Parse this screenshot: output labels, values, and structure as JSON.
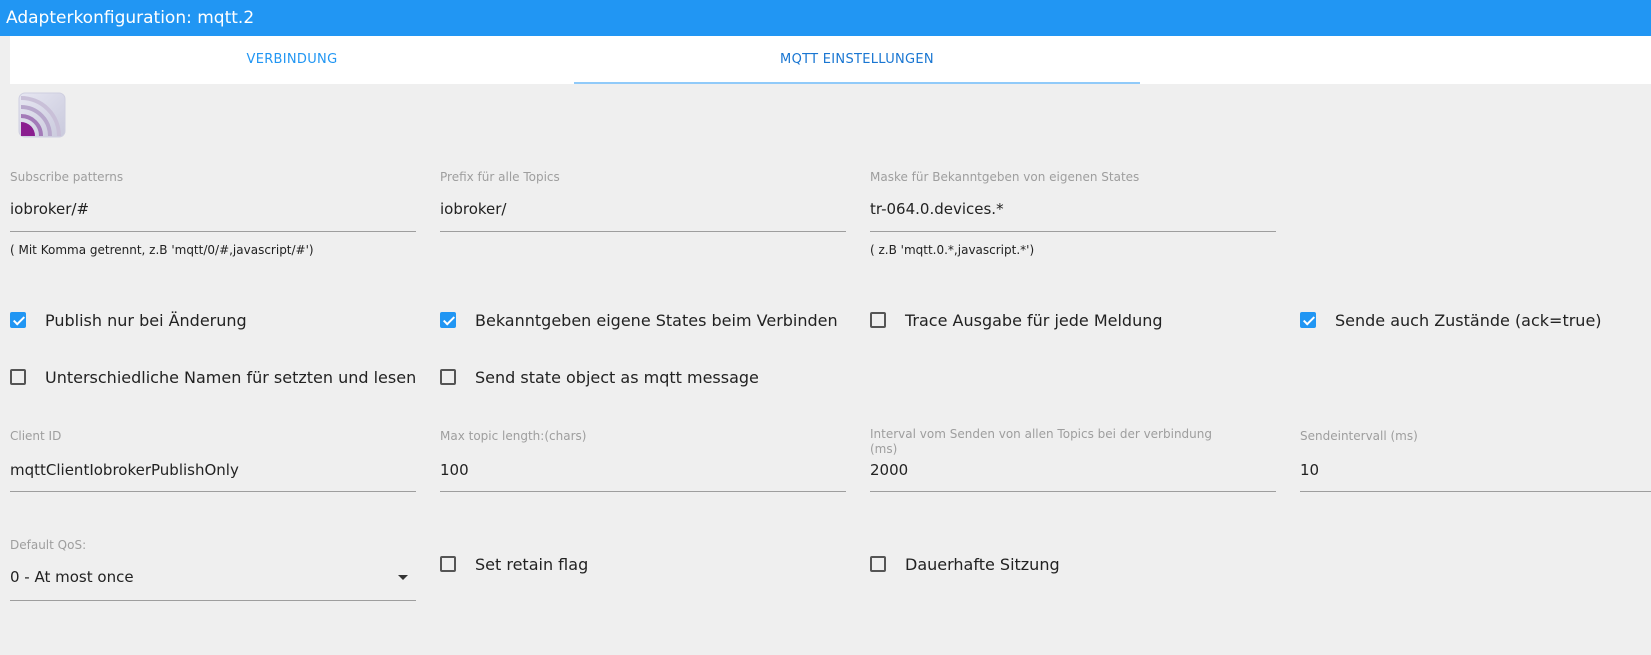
{
  "window": {
    "title": "Adapterkonfiguration: mqtt.2"
  },
  "tabs": [
    {
      "label": "VERBINDUNG",
      "active": false
    },
    {
      "label": "MQTT EINSTELLUNGEN",
      "active": true
    }
  ],
  "colors": {
    "accent": "#2196f3",
    "background": "#efefef"
  },
  "logo": {
    "icon": "mqtt-logo-icon"
  },
  "fields": {
    "subscribe": {
      "label": "Subscribe patterns",
      "value": "iobroker/#",
      "help": "( Mit Komma getrennt, z.B 'mqtt/0/#,javascript/#')"
    },
    "prefix": {
      "label": "Prefix für alle Topics",
      "value": "iobroker/"
    },
    "mask": {
      "label": "Maske für Bekanntgeben von eigenen States",
      "value": "tr-064.0.devices.*",
      "help": "( z.B 'mqtt.0.*,javascript.*')"
    },
    "client_id": {
      "label": "Client ID",
      "value": "mqttClientIobrokerPublishOnly"
    },
    "max_topic": {
      "label": "Max topic length:(chars)",
      "value": "100"
    },
    "interval_all": {
      "label_line1": "Interval vom Senden von allen Topics bei der verbindung",
      "label_line2": "(ms)",
      "value": "2000"
    },
    "send_interval": {
      "label": "Sendeintervall (ms)",
      "value": "10"
    },
    "qos": {
      "label": "Default QoS:",
      "value": "0 - At most once"
    }
  },
  "checkboxes": {
    "publish_on_change": {
      "label": "Publish nur bei Änderung",
      "checked": true
    },
    "announce_own_states": {
      "label": "Bekanntgeben eigene States beim Verbinden",
      "checked": true
    },
    "trace_output": {
      "label": "Trace Ausgabe für jede Meldung",
      "checked": false
    },
    "send_ack_states": {
      "label": "Sende auch Zustände (ack=true)",
      "checked": true
    },
    "different_names": {
      "label": "Unterschiedliche Namen für setzten und lesen",
      "checked": false
    },
    "send_state_object": {
      "label": "Send state object as mqtt message",
      "checked": false
    },
    "retain_flag": {
      "label": "Set retain flag",
      "checked": false
    },
    "persistent_session": {
      "label": "Dauerhafte Sitzung",
      "checked": false
    }
  }
}
